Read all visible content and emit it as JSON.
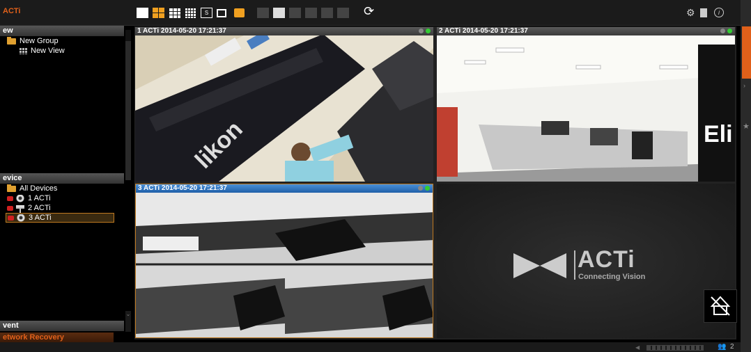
{
  "app": {
    "brand": "ACTi"
  },
  "toolbar": {
    "layouts": [
      "single-layout-icon",
      "quad-layout-icon",
      "nine-layout-icon",
      "sixteen-layout-icon",
      "s-layout-icon",
      "window-layout-icon",
      "alert-icon"
    ],
    "ptz": [
      "ptz-1-icon",
      "ptz-2-icon",
      "ptz-3-icon",
      "ptz-4-icon",
      "ptz-5-icon"
    ],
    "right_icons": [
      "settings-gear-icon",
      "document-icon",
      "info-icon"
    ]
  },
  "view_panel": {
    "header": "ew",
    "group": "New Group",
    "view": "New View"
  },
  "device_panel": {
    "header": "evice",
    "root": "All Devices",
    "devices": [
      {
        "name": "1 ACTi",
        "cam": "dome"
      },
      {
        "name": "2 ACTi",
        "cam": "bullet"
      },
      {
        "name": "3 ACTi",
        "cam": "dome",
        "selected": true
      }
    ]
  },
  "event_panel": {
    "header": "vent",
    "item": "etwork Recovery"
  },
  "videos": [
    {
      "title": "1 ACTi  2014-05-20 17:21:37",
      "active": false
    },
    {
      "title": "2 ACTi  2014-05-20 17:21:37",
      "active": false
    },
    {
      "title": "3 ACTi  2014-05-20 17:21:37",
      "active": true
    }
  ],
  "logo": {
    "name": "ACTi",
    "tagline": "Connecting Vision"
  },
  "status": {
    "user_count": "2"
  },
  "colors": {
    "accent": "#e0601a",
    "selected_border": "#c07a20",
    "active_title": "#2f74c4"
  }
}
